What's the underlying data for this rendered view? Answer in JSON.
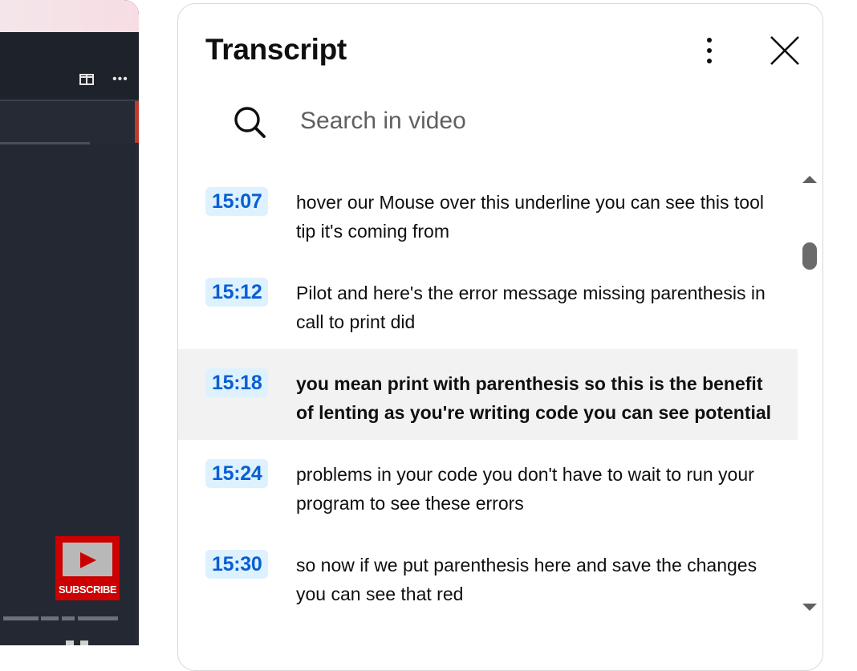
{
  "video": {
    "subscribe_label": "SUBSCRIBE"
  },
  "transcript": {
    "title": "Transcript",
    "search": {
      "placeholder": "Search in video",
      "value": ""
    },
    "segments": [
      {
        "time": "15:07",
        "text": "hover our Mouse over this underline you can see this tool tip it's coming from",
        "active": false
      },
      {
        "time": "15:12",
        "text": "Pilot and here's the error message missing parenthesis in call to print did",
        "active": false
      },
      {
        "time": "15:18",
        "text": "you mean print with parenthesis so this is the benefit of lenting as you're writing code you can see potential",
        "active": true
      },
      {
        "time": "15:24",
        "text": "problems in your code you don't have to wait to run your program to see these errors",
        "active": false
      },
      {
        "time": "15:30",
        "text": "so now if we put parenthesis here and save the changes you can see that red",
        "active": false
      }
    ]
  },
  "colors": {
    "timestamp_bg": "#def1ff",
    "timestamp_text": "#065fd4",
    "active_row_bg": "#f2f2f2",
    "subscribe_red": "#cc0000"
  },
  "icons": [
    "panel-layout-icon",
    "more-horizontal-icon",
    "play-icon",
    "more-vertical-icon",
    "close-icon",
    "search-icon",
    "scroll-up-arrow-icon",
    "scroll-down-arrow-icon"
  ]
}
